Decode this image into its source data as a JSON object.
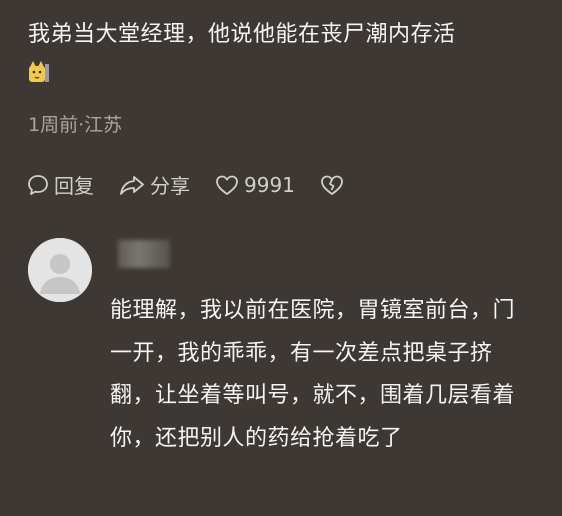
{
  "comment": {
    "text": "我弟当大堂经理，他说他能在丧尸潮内存活",
    "sticker_icon": "cat-sticker",
    "meta": "1周前·江苏",
    "actions": {
      "reply_label": "回复",
      "share_label": "分享",
      "like_count": "9991"
    }
  },
  "reply": {
    "text": "能理解，我以前在医院，胃镜室前台，门一开，我的乖乖，有一次差点把桌子挤翻，让坐着等叫号，就不，围着几层看着你，还把别人的药给抢着吃了"
  }
}
